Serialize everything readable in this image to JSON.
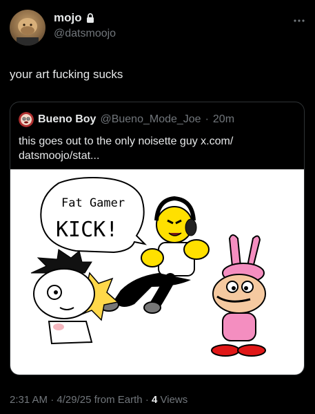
{
  "tweet": {
    "author_name": "mojo",
    "author_handle": "@datsmoojo",
    "text": "your art fucking sucks",
    "time": "2:31 AM",
    "date": "4/29/25",
    "source": "from Earth",
    "views_count": "4",
    "views_label": "Views",
    "separator": "·"
  },
  "quote": {
    "author_name": "Bueno Boy",
    "author_handle": "@Bueno_Mode_Joe",
    "time": "20m",
    "separator": "·",
    "text": "this goes out to the only noisette guy x.com/\ndatsmoojo/stat...",
    "image": {
      "speech_line1": "Fat Gamer",
      "speech_line2": "KICK!"
    }
  },
  "icons": {
    "lock": "lock-icon",
    "more": "more-options-icon",
    "quote_avatar": "angry-face-avatar-icon"
  },
  "colors": {
    "background": "#000000",
    "text": "#e7e9ea",
    "secondary": "#71767b",
    "border": "#2f3336"
  }
}
